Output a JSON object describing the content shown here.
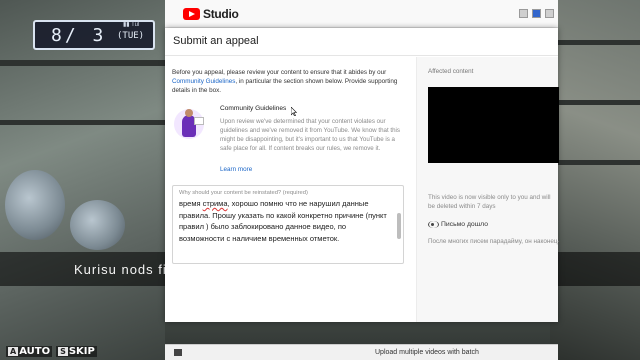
{
  "game": {
    "date": "8/ 3",
    "day_of_week": "(TUE)",
    "signal": "▮▮ Tul",
    "subtitle": "Kurisu nods fi",
    "controls": [
      {
        "key": "A",
        "label": "AUTO"
      },
      {
        "key": "S",
        "label": "SKIP"
      }
    ]
  },
  "studio": {
    "logo_text": "Studio",
    "upload_text": "Upload multiple videos with batch"
  },
  "modal": {
    "title": "Submit an appeal",
    "intro_before": "Before you appeal, please review your content to ensure that it abides by our ",
    "intro_link": "Community Guidelines",
    "intro_after": ", in particular the section shown below. Provide supporting details in the box.",
    "guidelines": {
      "title": "Community Guidelines",
      "text": "Upon review we've determined that your content violates our guidelines and we've removed it from YouTube. We know that this might be disappointing, but it's important to us that YouTube is a safe place for all. If content breaks our rules, we remove it.",
      "learn_more": "Learn more"
    },
    "reason": {
      "label": "Why should your content be reinstated? (required)",
      "text_before": "время ",
      "text_underlined": "стрима",
      "text_after": ", хорошо помню что не нарушил данные правила. Прошу указать по какой конкретно причине (пункт правил ) было заблокировано данное видео, по возможности с наличием временных отметок."
    },
    "affected": {
      "label": "Affected content",
      "visibility_note": "This video is now visible only to you and will be deleted within 7 days",
      "video_title": "Письмо дошло",
      "video_description": "После многих писем парадайму, он наконец-то ответил"
    }
  },
  "colors": {
    "link": "#1a65c7",
    "youtube_red": "#ff0000",
    "guideline_purple": "#6b2fb8"
  }
}
